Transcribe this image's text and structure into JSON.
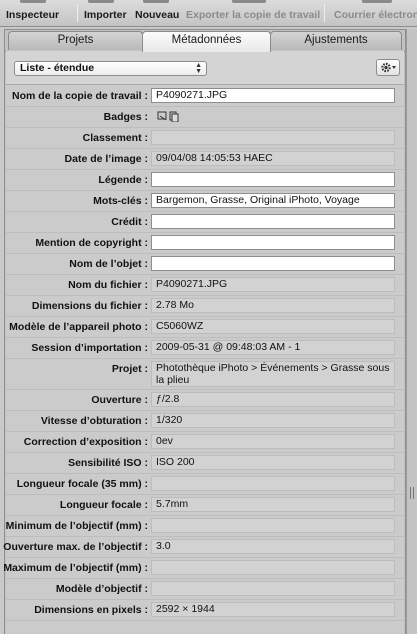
{
  "toolbar": {
    "items": [
      "Inspecteur",
      "Importer",
      "Nouveau",
      "Exporter la copie de travail",
      "Courrier électroni"
    ]
  },
  "tabs": [
    "Projets",
    "Métadonnées",
    "Ajustements"
  ],
  "active_tab": "Métadonnées",
  "view_selector": {
    "value": "Liste - étendue"
  },
  "fields": [
    {
      "label": "Nom de la copie de travail :",
      "value": "P4090271.JPG",
      "editable": true
    },
    {
      "label": "Badges :",
      "value": "",
      "editable": false
    },
    {
      "label": "Classement :",
      "value": "",
      "editable": false
    },
    {
      "label": "Date de l’image :",
      "value": "09/04/08 14:05:53 HAEC",
      "editable": false
    },
    {
      "label": "Légende :",
      "value": "",
      "editable": true
    },
    {
      "label": "Mots-clés :",
      "value": "Bargemon, Grasse, Original iPhoto, Voyage",
      "editable": true
    },
    {
      "label": "Crédit :",
      "value": "",
      "editable": true
    },
    {
      "label": "Mention de copyright :",
      "value": "",
      "editable": true
    },
    {
      "label": "Nom de l’objet :",
      "value": "",
      "editable": true
    },
    {
      "label": "Nom du fichier :",
      "value": "P4090271.JPG",
      "editable": false
    },
    {
      "label": "Dimensions du fichier :",
      "value": "2.78 Mo",
      "editable": false
    },
    {
      "label": "Modèle de l’appareil photo :",
      "value": "C5060WZ",
      "editable": false
    },
    {
      "label": "Session d’importation :",
      "value": "2009-05-31 @ 09:48:03 AM - 1",
      "editable": false
    },
    {
      "label": "Projet :",
      "value": "Photothèque iPhoto > Événements > Grasse sous la plieu",
      "editable": false
    },
    {
      "label": "Ouverture :",
      "value": "ƒ/2.8",
      "editable": false
    },
    {
      "label": "Vitesse d’obturation :",
      "value": "1/320",
      "editable": false
    },
    {
      "label": "Correction d’exposition :",
      "value": "0ev",
      "editable": false
    },
    {
      "label": "Sensibilité ISO :",
      "value": "ISO 200",
      "editable": false
    },
    {
      "label": "Longueur focale (35 mm) :",
      "value": "",
      "editable": false
    },
    {
      "label": "Longueur focale :",
      "value": "5.7mm",
      "editable": false
    },
    {
      "label": "Minimum de l’objectif (mm) :",
      "value": "",
      "editable": false
    },
    {
      "label": "Ouverture max. de l’objectif :",
      "value": "3.0",
      "editable": false
    },
    {
      "label": "Maximum de l’objectif (mm) :",
      "value": "",
      "editable": false
    },
    {
      "label": "Modèle d’objectif :",
      "value": "",
      "editable": false
    },
    {
      "label": "Dimensions en pixels :",
      "value": "2592 × 1944",
      "editable": false
    }
  ],
  "colors": {
    "panel": "#cbcbcb",
    "editable_field": "#ffffff",
    "readonly_field": "#d2d2d2"
  }
}
